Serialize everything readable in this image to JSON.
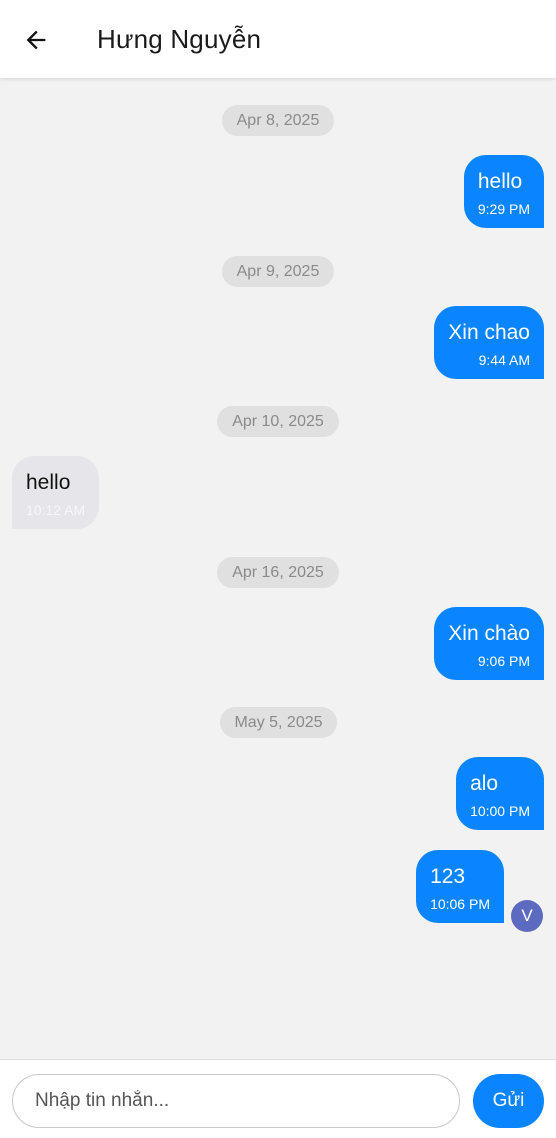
{
  "header": {
    "back_icon": "arrow-left-icon",
    "title": "Hưng Nguyễn"
  },
  "messages": [
    {
      "type": "date",
      "label": "Apr 8, 2025"
    },
    {
      "type": "sent",
      "text": "hello",
      "time": "9:29 PM"
    },
    {
      "type": "date",
      "label": "Apr 9, 2025"
    },
    {
      "type": "sent",
      "text": "Xin chao",
      "time": "9:44 AM"
    },
    {
      "type": "date",
      "label": "Apr 10, 2025"
    },
    {
      "type": "received",
      "text": "hello",
      "time": "10:12 AM"
    },
    {
      "type": "date",
      "label": "Apr 16, 2025"
    },
    {
      "type": "sent",
      "text": "Xin chào",
      "time": "9:06 PM"
    },
    {
      "type": "date",
      "label": "May 5, 2025"
    },
    {
      "type": "sent",
      "text": "alo",
      "time": "10:00 PM"
    },
    {
      "type": "sent",
      "text": "123",
      "time": "10:06 PM"
    }
  ],
  "avatar": {
    "initial": "V",
    "color": "#5c6bc0"
  },
  "composer": {
    "placeholder": "Nhập tin nhắn...",
    "send_label": "Gửi"
  },
  "colors": {
    "accent": "#0a84ff",
    "background": "#f2f2f2",
    "received_bubble": "#e6e6ea",
    "date_pill": "#e0e0e0"
  }
}
